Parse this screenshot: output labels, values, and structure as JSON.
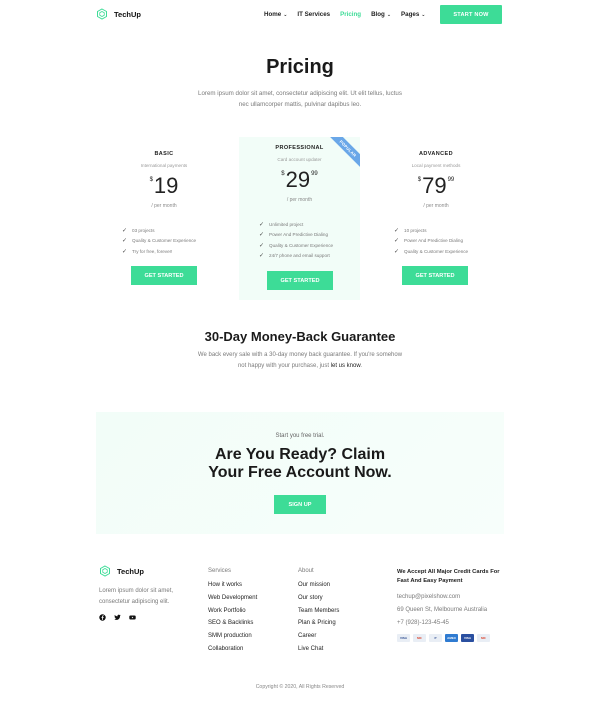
{
  "header": {
    "logo": "TechUp",
    "nav": [
      {
        "label": "Home",
        "dropdown": true
      },
      {
        "label": "IT Services",
        "dropdown": false
      },
      {
        "label": "Pricing",
        "dropdown": false,
        "active": true
      },
      {
        "label": "Blog",
        "dropdown": true
      },
      {
        "label": "Pages",
        "dropdown": true
      }
    ],
    "cta": "START NOW"
  },
  "hero": {
    "title": "Pricing",
    "subtitle": "Lorem ipsum dolor sit amet, consectetur adipiscing elit. Ut elit tellus, luctus nec ullamcorper mattis, pulvinar dapibus leo."
  },
  "plans": [
    {
      "name": "BASIC",
      "desc": "International payments",
      "currency": "$",
      "amount": "19",
      "cents": "",
      "per": "/ per month",
      "features": [
        "03 projects",
        "Quality & Customer Experience",
        "Try for free, forever!"
      ],
      "button": "GET STARTED"
    },
    {
      "name": "PROFESSIONAL",
      "desc": "Card account updater",
      "currency": "$",
      "amount": "29",
      "cents": "99",
      "per": "/ per month",
      "features": [
        "Unlimited project",
        "Power And Predictive Dialing",
        "Quality & Customer Experience",
        "24/7 phone and email support"
      ],
      "button": "GET STARTED",
      "badge": "POPULAR"
    },
    {
      "name": "ADVANCED",
      "desc": "Local payment methods",
      "currency": "$",
      "amount": "79",
      "cents": "99",
      "per": "/ per month",
      "features": [
        "10 projects",
        "Power And Predictive Dialing",
        "Quality & Customer Experience"
      ],
      "button": "GET STARTED"
    }
  ],
  "guarantee": {
    "title": "30-Day Money-Back Guarantee",
    "text": "We back every sale with a 30-day money back guarantee. If you're somehow not happy with your purchase, just ",
    "link": "let us know",
    "end": "."
  },
  "cta": {
    "small": "Start you free trial.",
    "title_line1": "Are You Ready? Claim",
    "title_line2": "Your Free Account Now.",
    "button": "SIGN UP"
  },
  "footer": {
    "logo": "TechUp",
    "about": "Lorem ipsum dolor sit amet, consectetur adipiscing elit.",
    "social": [
      "facebook-icon",
      "twitter-icon",
      "youtube-icon"
    ],
    "services_head": "Services",
    "services": [
      "How it works",
      "Web Development",
      "Work Portfolio",
      "SEO & Backlinks",
      "SMM production",
      "Collaboration"
    ],
    "about_head": "About",
    "about_links": [
      "Our mission",
      "Our story",
      "Team Members",
      "Plan & Pricing",
      "Career",
      "Live Chat"
    ],
    "contact_head": "We Accept All Major Credit Cards For Fast And Easy Payment",
    "email": "techup@pixelshow.com",
    "address": "69 Queen St, Melbourne Australia",
    "phone": "+7 (928)-123-45-45",
    "payment_cards": [
      "VISA",
      "MC",
      "P",
      "AMEX",
      "VISA",
      "MC"
    ],
    "copyright": "Copyright © 2020, All Rights Reserved"
  },
  "colors": {
    "accent": "#3ddc97",
    "badge": "#6aa7e8",
    "pro_bg": "#f2fdf8"
  }
}
